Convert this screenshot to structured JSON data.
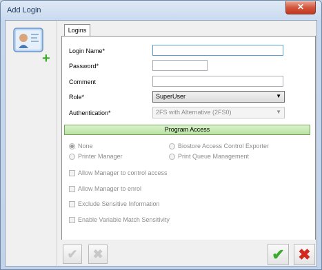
{
  "window": {
    "title": "Add Login",
    "close_label": "✕"
  },
  "icons": {
    "user_card": "user-card-icon",
    "add": "plus-icon"
  },
  "tabs": [
    {
      "label": "Logins"
    }
  ],
  "form": {
    "login_name": {
      "label": "Login Name*",
      "value": ""
    },
    "password": {
      "label": "Password*",
      "value": ""
    },
    "comment": {
      "label": "Comment",
      "value": ""
    },
    "role": {
      "label": "Role*",
      "value": "SuperUser"
    },
    "authentication": {
      "label": "Authentication*",
      "value": "2FS with Alternative (2FS0)"
    }
  },
  "program_access": {
    "title": "Program Access",
    "options": [
      {
        "label": "None",
        "selected": true
      },
      {
        "label": "Printer Manager",
        "selected": false
      },
      {
        "label": "Biostore Access Control Exporter",
        "selected": false
      },
      {
        "label": "Print Queue Management",
        "selected": false
      }
    ],
    "checkboxes": [
      {
        "label": "Allow Manager to control access",
        "checked": false
      },
      {
        "label": "Allow Manager to enrol",
        "checked": false
      },
      {
        "label": "Exclude Sensitive Information",
        "checked": false
      },
      {
        "label": "Enable Variable Match Sensitivity",
        "checked": false
      }
    ]
  },
  "buttons": {
    "ok_symbol": "✔",
    "cancel_symbol": "✖"
  },
  "colors": {
    "ok": "#3aab2a",
    "cancel": "#d2281e",
    "section": "#b9e3a1",
    "focus": "#5c9fd6"
  }
}
